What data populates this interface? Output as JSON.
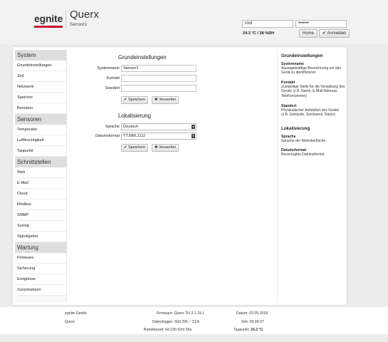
{
  "header": {
    "logo": "egnite",
    "product": "Querx",
    "device": "Sensor1",
    "user_value": "root",
    "password_value": "•••••••",
    "reading": "24.3 °C / 28 %RH",
    "home_label": "Home",
    "login_label": "✔ Anmelden",
    "accent": "#c8102e"
  },
  "sidebar": {
    "sections": [
      {
        "title": "System",
        "items": [
          "Grundeinstellungen",
          "Zeit",
          "Netzwerk",
          "Speicher",
          "Benutzer"
        ]
      },
      {
        "title": "Sensoren",
        "items": [
          "Temperatur",
          "Luftfeuchtigkeit",
          "Taupunkt"
        ]
      },
      {
        "title": "Schnittstellen",
        "items": [
          "Web",
          "E-Mail",
          "Cloud",
          "Modbus",
          "SNMP",
          "Syslog",
          "Signalgeber"
        ]
      },
      {
        "title": "Wartung",
        "items": [
          "Firmware",
          "Sicherung",
          "Ereignisse",
          "Zurücksetzen"
        ]
      }
    ]
  },
  "basic": {
    "title": "Grundeinstellungen",
    "fields": [
      {
        "label": "Systemname",
        "value": "Sensor1"
      },
      {
        "label": "Kontakt",
        "value": ""
      },
      {
        "label": "Standort",
        "value": ""
      }
    ],
    "save_label": "✔ Speichern",
    "discard_label": "✖ Verwerfen"
  },
  "localization": {
    "title": "Lokalisierung",
    "language_label": "Sprache",
    "language_value": "Deutsch",
    "date_format_label": "Datumsformat",
    "date_format_value": "TT.MM.JJJJ",
    "save_label": "✔ Speichern",
    "discard_label": "✖ Verwerfen"
  },
  "help": {
    "title1": "Grundeinstellungen",
    "t_systemname": "Systemname",
    "d_systemname": "Aussagekräftige Bezeichnung um das Gerät zu identifizieren",
    "t_kontakt": "Kontakt",
    "d_kontakt": "Zuständige Stelle für die Verwaltung des Geräts (z.B. Name, E-Mail-Adresse, Telefonnummer)",
    "t_standort": "Standort",
    "d_standort": "Physikalischer Aufstellort des Geräts (z.B. Gebäude, Stockwerk, Raum)",
    "title2": "Lokalisierung",
    "t_sprache": "Sprache",
    "d_sprache": "Sprache der Weboberfläche",
    "t_datum": "Datumsformat",
    "d_datum": "Bevorzugtes Datumsformat"
  },
  "footer": {
    "company": "egnite GmbH",
    "product": "Querx",
    "firmware": "Firmware: Querx TH 3.1.19.1",
    "datalogger": "Datenlogger: 60d 20h ~ 21%",
    "uptime": "Betriebszeit: 6d 23h 52m 55s",
    "date": "Datum: 02.05.2018",
    "time": "Zeit: 09:09:27",
    "dewpoint_label": "Taupunkt:",
    "dewpoint_value": "24.3 °C"
  }
}
